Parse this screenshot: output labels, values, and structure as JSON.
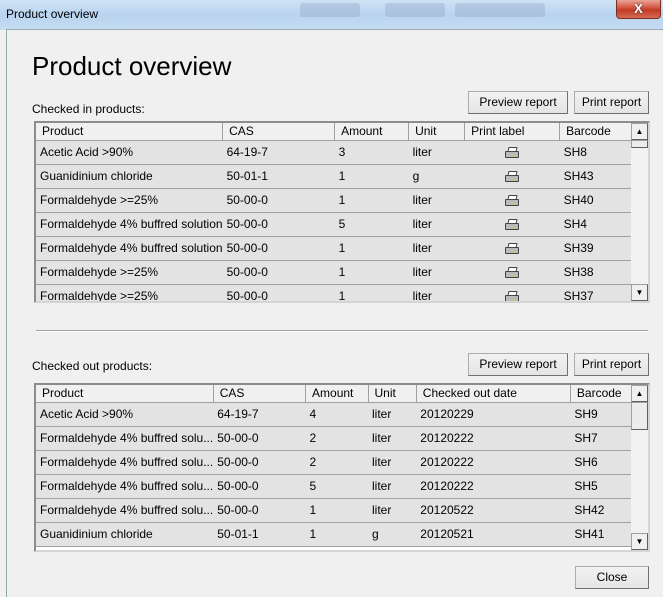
{
  "window": {
    "title": "Product overview",
    "close_glyph": "X"
  },
  "page_title": "Product overview",
  "checked_in": {
    "label": "Checked in products:",
    "preview_button": "Preview report",
    "print_button": "Print report",
    "columns": [
      "Product",
      "CAS",
      "Amount",
      "Unit",
      "Print label",
      "Barcode"
    ],
    "print_icon": "printer-icon",
    "rows": [
      {
        "product": "Acetic Acid >90%",
        "cas": "64-19-7",
        "amount": "3",
        "unit": "liter",
        "barcode": "SH8"
      },
      {
        "product": "Guanidinium chloride",
        "cas": "50-01-1",
        "amount": "1",
        "unit": "g",
        "barcode": "SH43"
      },
      {
        "product": "Formaldehyde >=25%",
        "cas": "50-00-0",
        "amount": "1",
        "unit": "liter",
        "barcode": "SH40"
      },
      {
        "product": "Formaldehyde 4% buffred solution",
        "cas": "50-00-0",
        "amount": "5",
        "unit": "liter",
        "barcode": "SH4"
      },
      {
        "product": "Formaldehyde 4% buffred solution",
        "cas": "50-00-0",
        "amount": "1",
        "unit": "liter",
        "barcode": "SH39"
      },
      {
        "product": "Formaldehyde >=25%",
        "cas": "50-00-0",
        "amount": "1",
        "unit": "liter",
        "barcode": "SH38"
      },
      {
        "product": "Formaldehyde >=25%",
        "cas": "50-00-0",
        "amount": "1",
        "unit": "liter",
        "barcode": "SH37"
      }
    ]
  },
  "checked_out": {
    "label": "Checked out products:",
    "preview_button": "Preview report",
    "print_button": "Print report",
    "columns": [
      "Product",
      "CAS",
      "Amount",
      "Unit",
      "Checked out date",
      "Barcode"
    ],
    "rows": [
      {
        "product": "Acetic Acid >90%",
        "cas": "64-19-7",
        "amount": "4",
        "unit": "liter",
        "date": "20120229",
        "barcode": "SH9"
      },
      {
        "product": "Formaldehyde 4% buffred solu...",
        "cas": "50-00-0",
        "amount": "2",
        "unit": "liter",
        "date": "20120222",
        "barcode": "SH7"
      },
      {
        "product": "Formaldehyde 4% buffred solu...",
        "cas": "50-00-0",
        "amount": "2",
        "unit": "liter",
        "date": "20120222",
        "barcode": "SH6"
      },
      {
        "product": "Formaldehyde 4% buffred solu...",
        "cas": "50-00-0",
        "amount": "5",
        "unit": "liter",
        "date": "20120222",
        "barcode": "SH5"
      },
      {
        "product": "Formaldehyde 4% buffred solu...",
        "cas": "50-00-0",
        "amount": "1",
        "unit": "liter",
        "date": "20120522",
        "barcode": "SH42"
      },
      {
        "product": "Guanidinium chloride",
        "cas": "50-01-1",
        "amount": "1",
        "unit": "g",
        "date": "20120521",
        "barcode": "SH41"
      }
    ]
  },
  "scroll_up_glyph": "▲",
  "scroll_down_glyph": "▼",
  "close_button": "Close"
}
